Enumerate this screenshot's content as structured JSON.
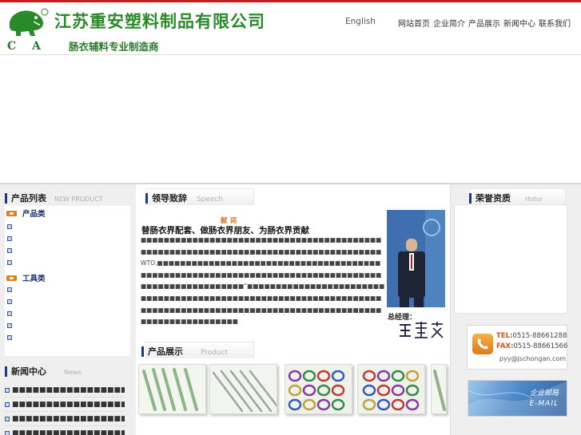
{
  "header": {
    "company_name": "江苏重安塑料制品有限公司",
    "slogan": "肠衣辅料专业制造商",
    "logo_letters": [
      "C",
      "A"
    ],
    "language_link": "English",
    "nav_items": [
      "网站首页",
      "企业简介",
      "产品展示",
      "新闻中心",
      "联系我们"
    ]
  },
  "product_list": {
    "title": "产品列表",
    "subtitle": "NEW PRODUCT",
    "categories": [
      {
        "label": "产品类",
        "item_count": 5
      },
      {
        "label": "工具类",
        "item_count": 4
      }
    ]
  },
  "news": {
    "title": "新闻中心",
    "subtitle": "News",
    "items": [
      "■■■■■■■■■■■■■■■■■■",
      "■■■■■■■■■■■■■■■■■■",
      "■■■■■■■■■■■■■■■■■■",
      "■■■■■■■■■■■■■■■■■■"
    ]
  },
  "speech": {
    "title": "领导致辞",
    "subtitle": "Speech",
    "small_title": "献 词",
    "headline": "替肠衣界配套、做肠衣界朋友、为肠衣界贡献",
    "body": "■■■■■■■■■■■■■■■■■■■■■■■■■■■■■■■■■■■■■■■■■■■■■■■■■■■■■■■■■■■■■■■■■■■■■■■■■■■■■■■■■■■■WTO,■■■■■■■■■■■■■■■■■■■■■■■■■■■■■■■■■■■■■■■■■■■■■■■■■■■■■■■■■■■■■■■■■■■■■■■■■■■■■■■■■■■■■■■■■■■■■■■■■■■“■■■■■■■■■■■■■■■■■■■■■■■■■■■■■■■■■■■■■■■■■■■■■■■■■■■■■■■■■■■■■■■■■■■■■■■■■■■■■■■■■■■■■■■■■■■■■■■■■■■■■■■■■■■■■■■■■■■■■■■■■■■■■",
    "gm_label": "总经理："
  },
  "products": {
    "title": "产品展示",
    "subtitle": "Product"
  },
  "honors": {
    "title": "荣誉资质",
    "subtitle": "Hotor"
  },
  "contact": {
    "tel_key": "TEL:",
    "tel": "0515-88661288",
    "fax_key": "FAX:",
    "fax": "0515-88661566",
    "email": "pyy@jschongan.com"
  },
  "mail_banner": {
    "line1": "企业邮局",
    "line2": "E-MAIL"
  },
  "colors": {
    "brand_green": "#2a8a2a",
    "accent_red": "#c91c1c",
    "section_bar": "#1b3a8a",
    "link_orange": "#d3531b"
  }
}
